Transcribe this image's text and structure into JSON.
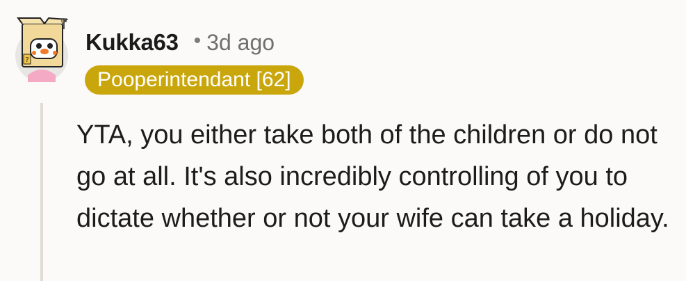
{
  "comment": {
    "username": "Kukka63",
    "separator": "•",
    "timestamp": "3d ago",
    "flair": "Pooperintendant [62]",
    "body": "YTA, you either take both of the children or do not go at all. It's also incredibly controlling of you to dictate whether or not your wife can take a holiday.",
    "avatar_icon": "robot-box-avatar-icon"
  },
  "colors": {
    "background": "#fbfaf9",
    "flair_background": "#c9a70c",
    "flair_text": "#ffffff",
    "username": "#1a1a1b",
    "timestamp": "#6f6f6f",
    "thread_line": "#e2dbd5",
    "body_text": "#1c1c1c"
  }
}
